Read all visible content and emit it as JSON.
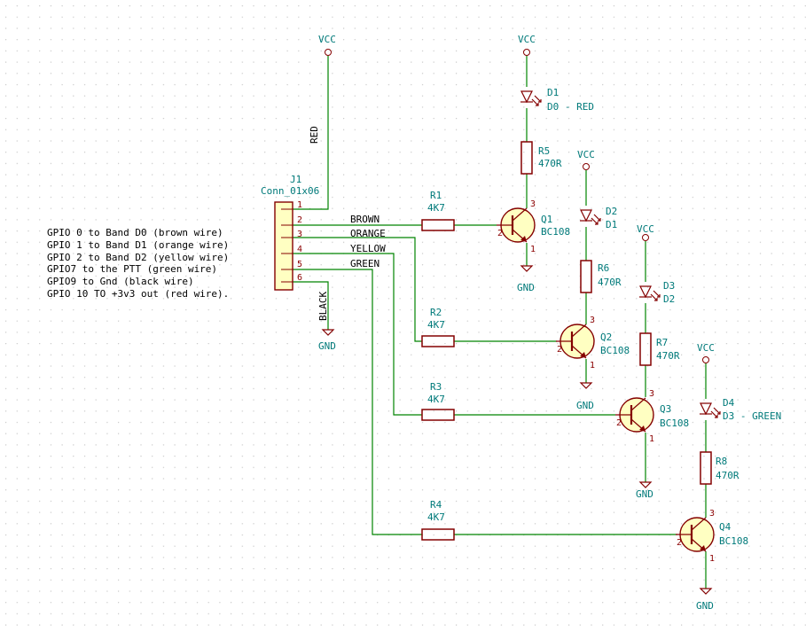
{
  "colors": {
    "wire": "#008400",
    "body": "#840000",
    "fill": "#ffffc2",
    "label": "#007a7a",
    "grid": "#c8c8c8"
  },
  "power": {
    "vcc": "VCC",
    "gnd": "GND"
  },
  "connector": {
    "ref": "J1",
    "value": "Conn_01x06",
    "pins": [
      "1",
      "2",
      "3",
      "4",
      "5",
      "6"
    ]
  },
  "nets": {
    "red": "RED",
    "brown": "BROWN",
    "orange": "ORANGE",
    "yellow": "YELLOW",
    "green": "GREEN",
    "black": "BLACK"
  },
  "resistors": {
    "r1": {
      "ref": "R1",
      "value": "4K7"
    },
    "r2": {
      "ref": "R2",
      "value": "4K7"
    },
    "r3": {
      "ref": "R3",
      "value": "4K7"
    },
    "r4": {
      "ref": "R4",
      "value": "4K7"
    },
    "r5": {
      "ref": "R5",
      "value": "470R"
    },
    "r6": {
      "ref": "R6",
      "value": "470R"
    },
    "r7": {
      "ref": "R7",
      "value": "470R"
    },
    "r8": {
      "ref": "R8",
      "value": "470R"
    }
  },
  "leds": {
    "d1": {
      "ref": "D1",
      "value": "D0 - RED"
    },
    "d2": {
      "ref": "D2",
      "value": "D1"
    },
    "d3": {
      "ref": "D3",
      "value": "D2"
    },
    "d4": {
      "ref": "D4",
      "value": "D3 - GREEN"
    }
  },
  "transistors": {
    "q1": {
      "ref": "Q1",
      "value": "BC108"
    },
    "q2": {
      "ref": "Q2",
      "value": "BC108"
    },
    "q3": {
      "ref": "Q3",
      "value": "BC108"
    },
    "q4": {
      "ref": "Q4",
      "value": "BC108"
    }
  },
  "pin_numbers": {
    "b": "2",
    "c": "3",
    "e": "1"
  },
  "notes": [
    "GPIO 0 to Band D0 (brown wire)",
    "GPIO 1 to Band D1 (orange wire)",
    "GPIO 2 to Band D2 (yellow wire)",
    "GPIO7 to the PTT (green wire)",
    "GPIO9 to Gnd (black wire)",
    "GPIO 10 TO +3v3 out (red wire)."
  ]
}
